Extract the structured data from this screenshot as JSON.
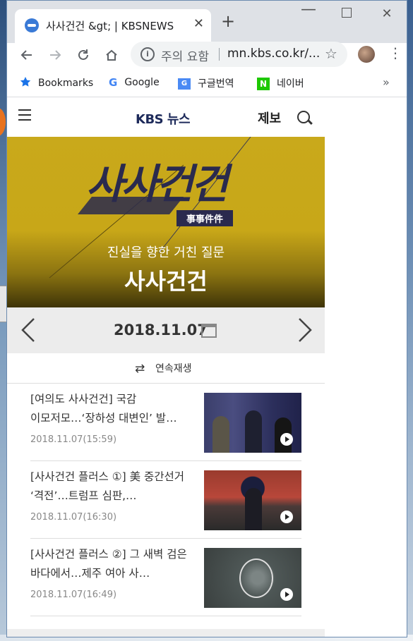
{
  "browser": {
    "tab_title": "사사건건 &gt; | KBSNEWS",
    "tab_close": "✕",
    "new_tab": "+",
    "min": "—",
    "close": "✕",
    "security_label": "주의 요함",
    "url": "mn.kbs.co.kr/...",
    "menu": "⋮"
  },
  "bookmarks": {
    "items": [
      {
        "label": "Bookmarks"
      },
      {
        "label": "Google"
      },
      {
        "label": "구글번역"
      },
      {
        "label": "네이버"
      }
    ],
    "more": "»"
  },
  "site": {
    "logo": "KBS 뉴스",
    "report": "제보"
  },
  "banner": {
    "logo_text": "사사건건",
    "hanja": "事事件件",
    "subtitle": "진실을 향한 거친 질문",
    "title": "사사건건"
  },
  "datebar": {
    "date": "2018.11.07"
  },
  "autoplay": {
    "label": "연속재생",
    "icon": "⇄"
  },
  "news": [
    {
      "title": "[여의도 사사건건] 국감 이모저모…‘장하성 대변인’ 발…",
      "date": "2018.11.07(15:59)"
    },
    {
      "title": "[사사건건 플러스 ①] 美 중간선거 ‘격전’…트럼프 심판,…",
      "date": "2018.11.07(16:30)"
    },
    {
      "title": "[사사건건 플러스 ②] 그 새벽 검은 바다에서…제주 여아 사…",
      "date": "2018.11.07(16:49)"
    }
  ],
  "colors": {
    "banner_yellow": "#c9a91b",
    "kbs_navy": "#1d2a5a"
  }
}
